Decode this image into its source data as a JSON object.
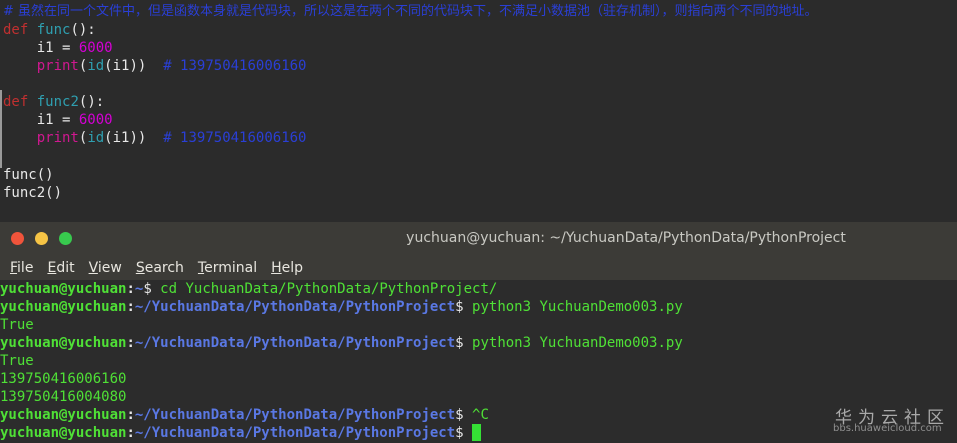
{
  "editor": {
    "comment_top": "# 虽然在同一个文件中，但是函数本身就是代码块，所以这是在两个不同的代码块下，不满足小数据池（驻存机制），则指向两个不同的地址。",
    "lines": {
      "l1": {
        "kw": "def",
        "name": "func",
        "rest": "():"
      },
      "l2": {
        "indent": "    ",
        "var": "i1 = ",
        "num": "6000"
      },
      "l3": {
        "indent": "    ",
        "print": "print",
        "p1": "(",
        "id": "id",
        "p2": "(i1))",
        "gap": "  ",
        "comment": "# 139750416006160"
      },
      "l5": {
        "kw": "def",
        "name": "func2",
        "rest": "():"
      },
      "l6": {
        "indent": "    ",
        "var": "i1 = ",
        "num": "6000"
      },
      "l7": {
        "indent": "    ",
        "print": "print",
        "p1": "(",
        "id": "id",
        "p2": "(i1))",
        "gap": "  ",
        "comment": "# 139750416006160"
      },
      "l9": "func()",
      "l10": "func2()"
    }
  },
  "terminal": {
    "title": "yuchuan@yuchuan: ~/YuchuanData/PythonData/PythonProject",
    "menu": [
      "File",
      "Edit",
      "View",
      "Search",
      "Terminal",
      "Help"
    ],
    "menu_first": [
      "F",
      "E",
      "V",
      "S",
      "T",
      "H"
    ],
    "menu_rest": [
      "ile",
      "dit",
      "iew",
      "earch",
      "erminal",
      "elp"
    ],
    "lines": [
      {
        "user": "yuchuan@yuchuan",
        "path": "~",
        "cmd": " cd YuchuanData/PythonData/PythonProject/"
      },
      {
        "user": "yuchuan@yuchuan",
        "path": "~/YuchuanData/PythonData/PythonProject",
        "cmd": " python3 YuchuanDemo003.py"
      },
      {
        "out": "True"
      },
      {
        "user": "yuchuan@yuchuan",
        "path": "~/YuchuanData/PythonData/PythonProject",
        "cmd": " python3 YuchuanDemo003.py"
      },
      {
        "out": "True"
      },
      {
        "out": "139750416006160"
      },
      {
        "out": "139750416004080"
      },
      {
        "user": "yuchuan@yuchuan",
        "path": "~/YuchuanData/PythonData/PythonProject",
        "cmd": " ^C"
      },
      {
        "user": "yuchuan@yuchuan",
        "path": "~/YuchuanData/PythonData/PythonProject",
        "cmd": " "
      }
    ]
  },
  "watermark": {
    "title": "华为云社区",
    "sub": "bbs.huaweicloud.com"
  },
  "colors": {
    "prompt_user": "#4fe036",
    "prompt_path": "#5a78e4",
    "keyword": "#c03030",
    "comment": "#2a3fd6",
    "number": "#d400d4"
  }
}
